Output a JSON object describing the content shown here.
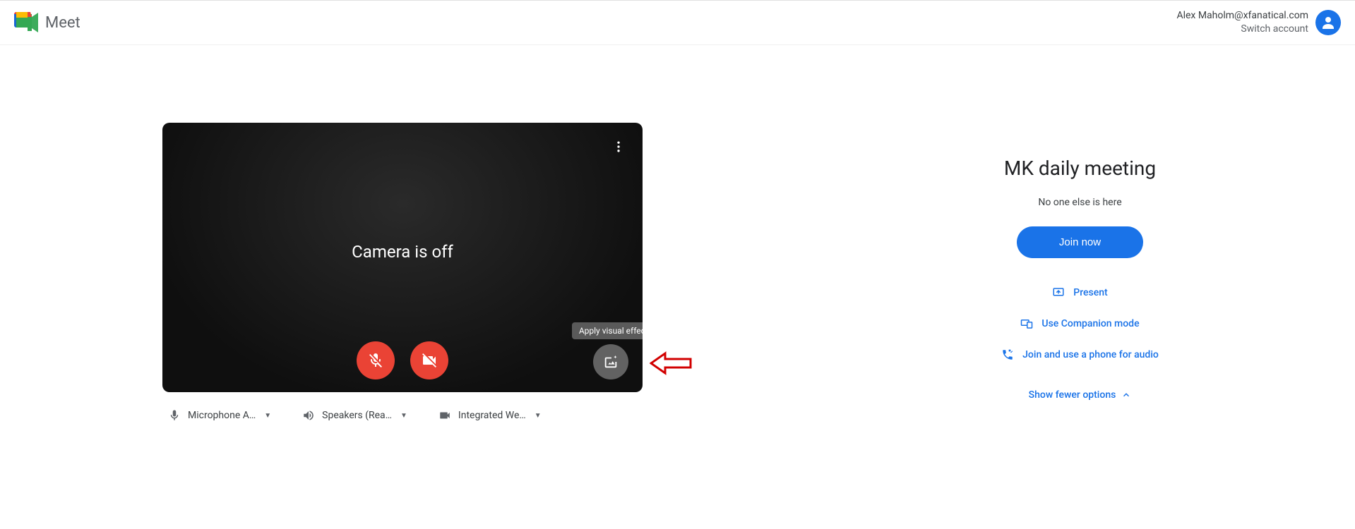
{
  "header": {
    "app_name": "Meet",
    "user_email": "Alex Maholm@xfanatical.com",
    "switch_account": "Switch account"
  },
  "preview": {
    "camera_status": "Camera is off",
    "tooltip": "Apply visual effects"
  },
  "devices": {
    "mic_label": "Microphone A…",
    "speaker_label": "Speakers (Rea…",
    "camera_label": "Integrated We…"
  },
  "meeting": {
    "title": "MK daily meeting",
    "status": "No one else is here",
    "join_label": "Join now",
    "present_label": "Present",
    "companion_label": "Use Companion mode",
    "phone_label": "Join and use a phone for audio",
    "fewer_label": "Show fewer options"
  }
}
